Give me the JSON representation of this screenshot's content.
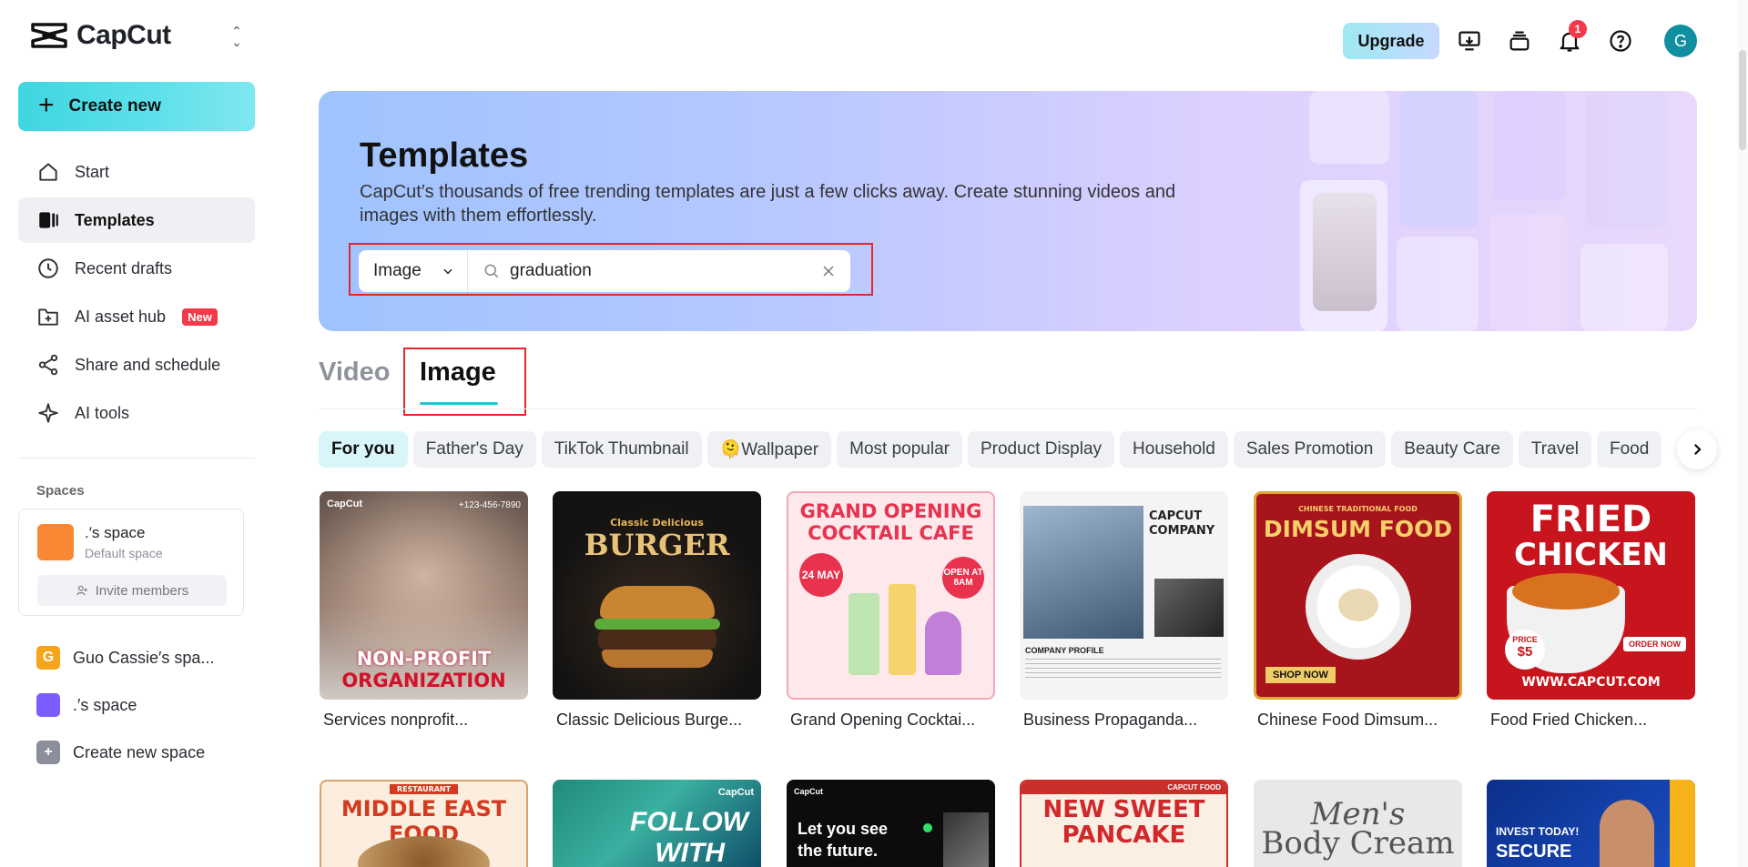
{
  "app": {
    "name": "CapCut"
  },
  "sidebar": {
    "create_label": "Create new",
    "items": [
      {
        "label": "Start"
      },
      {
        "label": "Templates"
      },
      {
        "label": "Recent drafts"
      },
      {
        "label": "AI asset hub",
        "badge": "New"
      },
      {
        "label": "Share and schedule"
      },
      {
        "label": "AI tools"
      }
    ],
    "spaces_title": "Spaces",
    "current_space": {
      "name": ".′s space",
      "role": "Default space",
      "invite_label": "Invite members"
    },
    "space_list": [
      {
        "initial": "G",
        "label": "Guo Cassie′s spa...",
        "color": "#f6a51a"
      },
      {
        "initial": "",
        "label": ".′s space",
        "color": "#7c5cff"
      },
      {
        "initial": "+",
        "label": "Create new space",
        "color": "#8a8f99"
      }
    ]
  },
  "topbar": {
    "upgrade_label": "Upgrade",
    "notification_count": "1",
    "avatar_initial": "G"
  },
  "banner": {
    "title": "Templates",
    "description": "CapCut′s thousands of free trending templates are just a few clicks away. Create stunning videos and images with them effortlessly."
  },
  "search": {
    "type_value": "Image",
    "query": "graduation"
  },
  "tabs": [
    {
      "label": "Video"
    },
    {
      "label": "Image"
    }
  ],
  "chips": [
    "For you",
    "Father's Day",
    "TikTok Thumbnail",
    "🫠Wallpaper",
    "Most popular",
    "Product Display",
    "Household",
    "Sales Promotion",
    "Beauty Care",
    "Travel",
    "Food"
  ],
  "templates": [
    {
      "title": "Services nonprofit...",
      "lines": [
        "NON-PROFIT",
        "ORGANIZATION"
      ],
      "brand": "CapCut",
      "phone": "+123-456-7890"
    },
    {
      "title": "Classic Delicious Burge...",
      "lines": [
        "Classic Delicious",
        "BURGER"
      ]
    },
    {
      "title": "Grand Opening Cocktai...",
      "lines": [
        "GRAND OPENING",
        "COCKTAIL CAFE",
        "24 MAY",
        "OPEN AT 8AM"
      ]
    },
    {
      "title": "Business Propaganda...",
      "lines": [
        "CAPCUT",
        "COMPANY",
        "COMPANY PROFILE"
      ]
    },
    {
      "title": "Chinese Food Dimsum...",
      "lines": [
        "CHINESE TRADITIONAL FOOD",
        "DIMSUM FOOD",
        "SHOP NOW"
      ]
    },
    {
      "title": "Food Fried Chicken...",
      "lines": [
        "FRIED",
        "CHICKEN",
        "PRICE",
        "$5",
        "ORDER NOW",
        "WWW.CAPCUT.COM"
      ]
    },
    {
      "title": "",
      "lines": [
        "RESTAURANT",
        "MIDDLE EAST FOOD"
      ]
    },
    {
      "title": "",
      "lines": [
        "FOLLOW",
        "WITH"
      ]
    },
    {
      "title": "",
      "lines": [
        "Let you see",
        "the future."
      ]
    },
    {
      "title": "",
      "lines": [
        "CAPCUT FOOD",
        "NEW SWEET",
        "PANCAKE"
      ]
    },
    {
      "title": "",
      "lines": [
        "Men's",
        "Body Cream"
      ]
    },
    {
      "title": "",
      "lines": [
        "INVEST TODAY!",
        "SECURE"
      ]
    }
  ]
}
